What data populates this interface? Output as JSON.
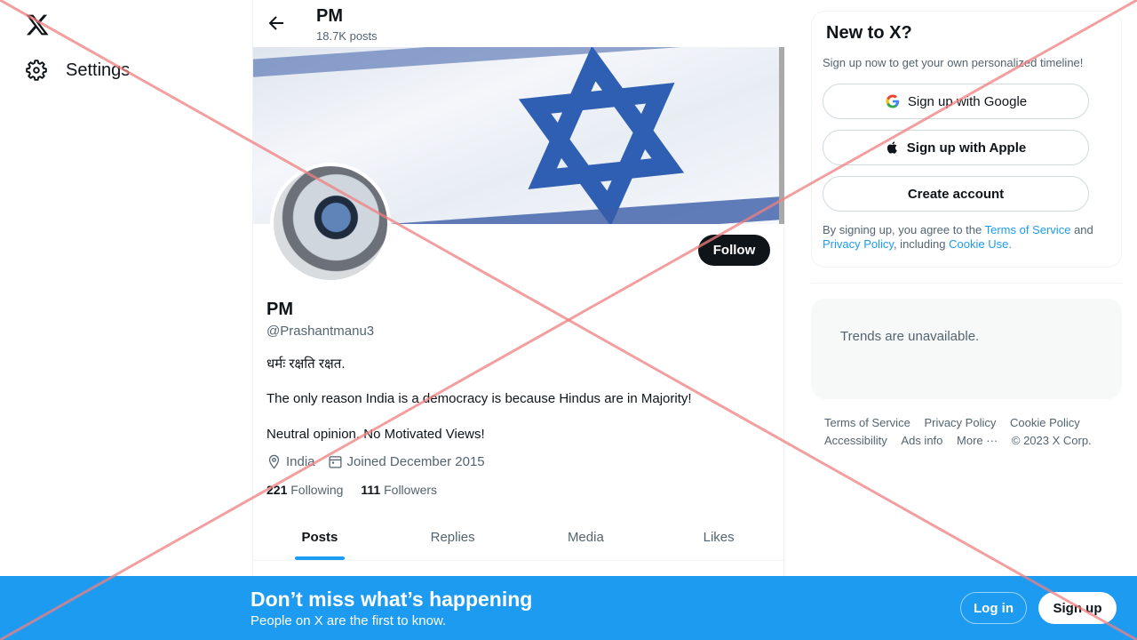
{
  "nav": {
    "settings_label": "Settings"
  },
  "header": {
    "name": "PM",
    "posts_count": "18.7K posts"
  },
  "profile": {
    "name": "PM",
    "handle": "@Prashantmanu3",
    "bio_line1": "धर्मः रक्षति रक्षत.",
    "bio_line2": "The only reason India is a democracy is because Hindus are in Majority!",
    "bio_line3": "Neutral opinion. No Motivated Views!",
    "location": "India",
    "joined": "Joined December 2015",
    "following_count": "221",
    "following_label": "Following",
    "followers_count": "111",
    "followers_label": "Followers",
    "follow_label": "Follow"
  },
  "tabs": [
    {
      "label": "Posts",
      "active": true
    },
    {
      "label": "Replies"
    },
    {
      "label": "Media"
    },
    {
      "label": "Likes"
    }
  ],
  "signup": {
    "title": "New to X?",
    "subtitle": "Sign up now to get your own personalized timeline!",
    "google_label": "Sign up with Google",
    "apple_label": "Sign up with Apple",
    "create_label": "Create account",
    "terms_prefix": "By signing up, you agree to the",
    "terms_link": "Terms of Service",
    "terms_and": "and",
    "privacy_link": "Privacy Policy",
    "terms_including": ", including",
    "cookie_link": "Cookie Use."
  },
  "trends": {
    "message": "Trends are unavailable."
  },
  "footer": {
    "links": [
      "Terms of Service",
      "Privacy Policy",
      "Cookie Policy",
      "Accessibility",
      "Ads info",
      "More ···",
      "© 2023 X Corp."
    ]
  },
  "bottom_bar": {
    "headline": "Don’t miss what’s happening",
    "subline": "People on X are the first to know.",
    "login_label": "Log in",
    "signup_label": "Sign up"
  },
  "colors": {
    "accent": "#1d9bf0",
    "text": "#0f1419",
    "muted": "#536471",
    "overlay": "#f08080"
  }
}
